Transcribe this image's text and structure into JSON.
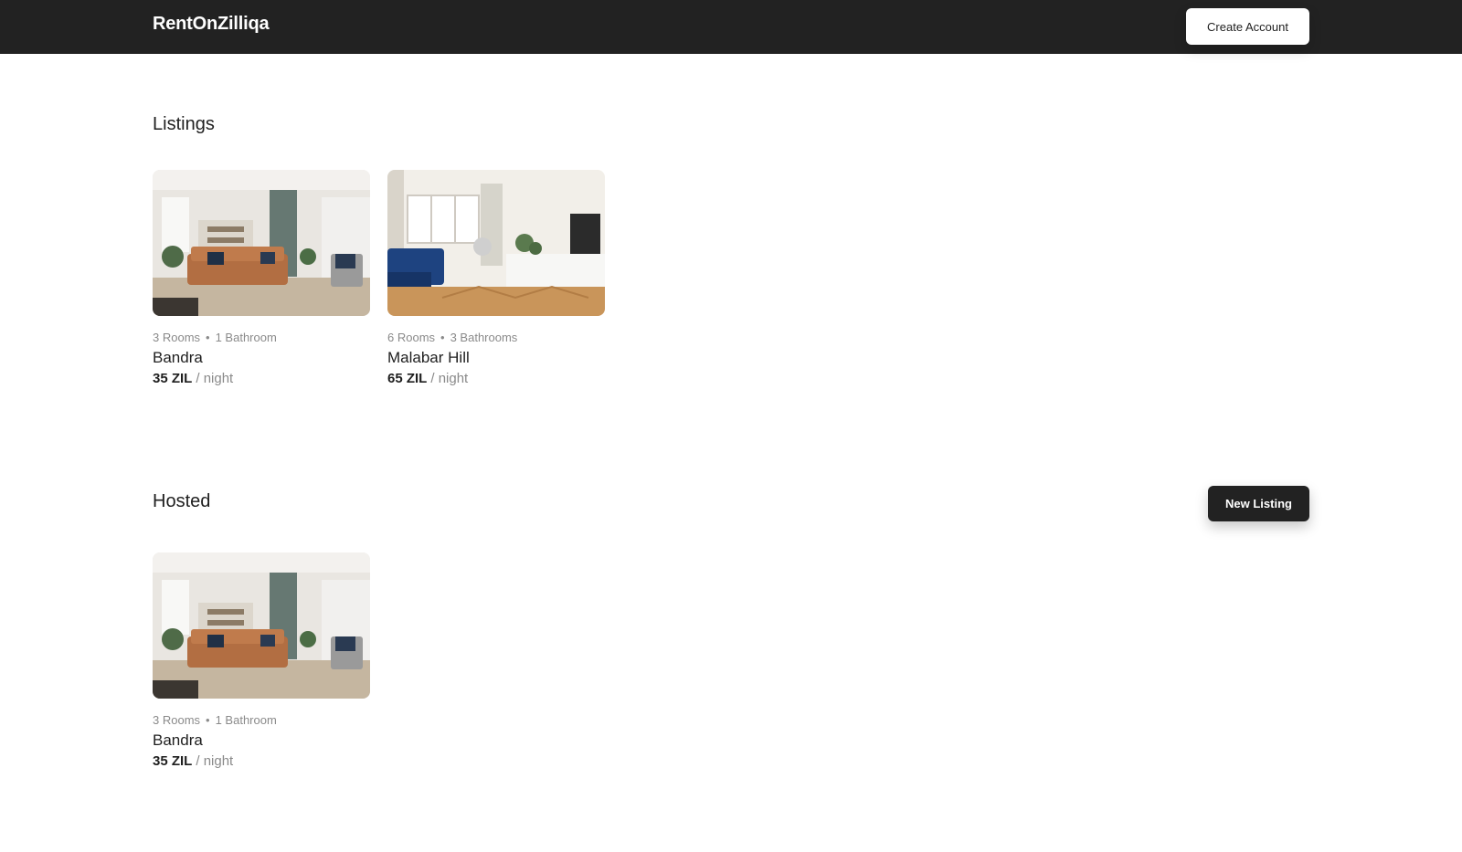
{
  "header": {
    "brand": "RentOnZilliqa",
    "create_account_label": "Create Account"
  },
  "sections": {
    "listings": {
      "title": "Listings",
      "cards": [
        {
          "rooms": "3 Rooms",
          "baths": "1 Bathroom",
          "name": "Bandra",
          "price": "35 ZIL",
          "unit": "/ night"
        },
        {
          "rooms": "6 Rooms",
          "baths": "3 Bathrooms",
          "name": "Malabar Hill",
          "price": "65 ZIL",
          "unit": "/ night"
        }
      ]
    },
    "hosted": {
      "title": "Hosted",
      "new_listing_label": "New Listing",
      "cards": [
        {
          "rooms": "3 Rooms",
          "baths": "1 Bathroom",
          "name": "Bandra",
          "price": "35 ZIL",
          "unit": "/ night"
        }
      ]
    }
  },
  "colors": {
    "header_bg": "#222222",
    "accent_dark": "#222222",
    "muted_text": "#8a8a8a"
  }
}
